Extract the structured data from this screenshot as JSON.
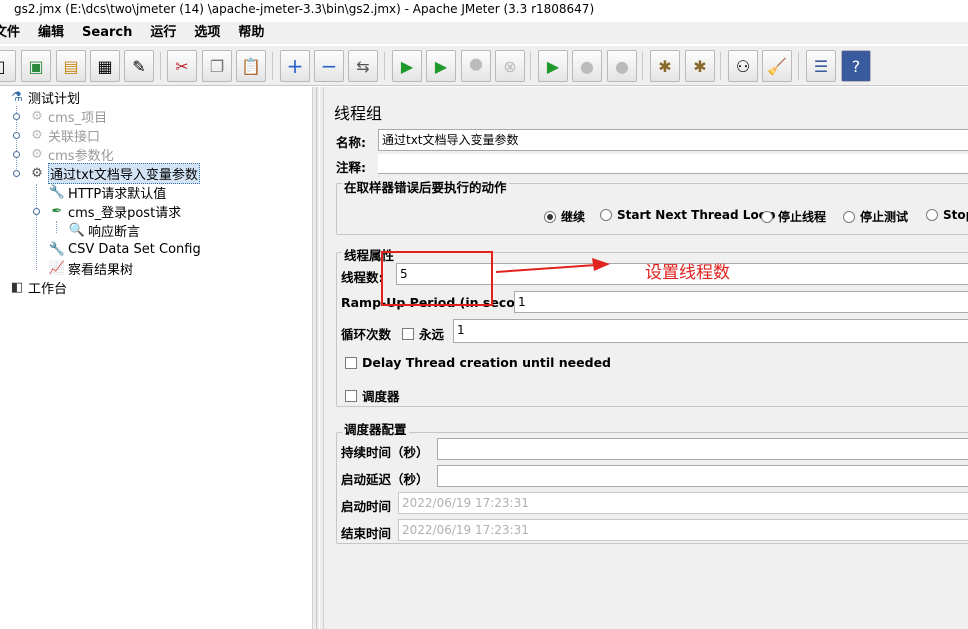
{
  "window": {
    "title": "gs2.jmx (E:\\dcs\\two\\jmeter  (14)  \\apache-jmeter-3.3\\bin\\gs2.jmx) - Apache JMeter (3.3 r1808647)"
  },
  "menu": {
    "items": [
      "文件",
      "编辑",
      "Search",
      "运行",
      "选项",
      "帮助"
    ]
  },
  "toolbar": {
    "buttons": [
      "new-icon",
      "templates-icon",
      "open-icon",
      "save-icon",
      "save-as-icon",
      "cut-icon",
      "copy-icon",
      "paste-icon",
      "expand-icon",
      "collapse-icon",
      "toggle-icon",
      "start-icon",
      "start-no-pause-icon",
      "stop-icon",
      "shutdown-icon",
      "remote-start-icon",
      "remote-stop-icon",
      "remote-shutdown-icon",
      "clear-icon",
      "clear-all-icon",
      "search-icon",
      "reset-search-icon",
      "function-helper-icon",
      "help-icon"
    ]
  },
  "tree": {
    "test_plan": "测试计划",
    "groups": [
      "cms_项目",
      "关联接口",
      "cms参数化"
    ],
    "selected": "通过txt文档导入变量参数",
    "children": [
      "HTTP请求默认值",
      "cms_登录post请求",
      "响应断言",
      "CSV Data Set Config",
      "察看结果树"
    ],
    "workbench": "工作台"
  },
  "panel": {
    "heading": "线程组",
    "name_label": "名称:",
    "name_value": "通过txt文档导入变量参数",
    "comment_label": "注释:",
    "error_action": {
      "title": "在取样器错误后要执行的动作",
      "options": [
        "继续",
        "Start Next Thread Loop",
        "停止线程",
        "停止测试",
        "Stop"
      ],
      "selected": "继续"
    },
    "thread_props": {
      "title": "线程属性",
      "threads_label": "线程数:",
      "threads_value": "5",
      "rampup_label": "Ramp-Up Period (in seconds):",
      "rampup_value": "1",
      "loop_label": "循环次数",
      "forever_label": "永远",
      "loop_value": "1",
      "delay_label": "Delay Thread creation until needed",
      "scheduler_label": "调度器"
    },
    "scheduler": {
      "title": "调度器配置",
      "duration_label": "持续时间（秒）",
      "startup_delay_label": "启动延迟（秒）",
      "start_time_label": "启动时间",
      "start_time_value": "2022/06/19 17:23:31",
      "end_time_label": "结束时间",
      "end_time_value": "2022/06/19 17:23:31"
    }
  },
  "annotation": {
    "text": "设置线程数",
    "color": "#e0221f"
  }
}
